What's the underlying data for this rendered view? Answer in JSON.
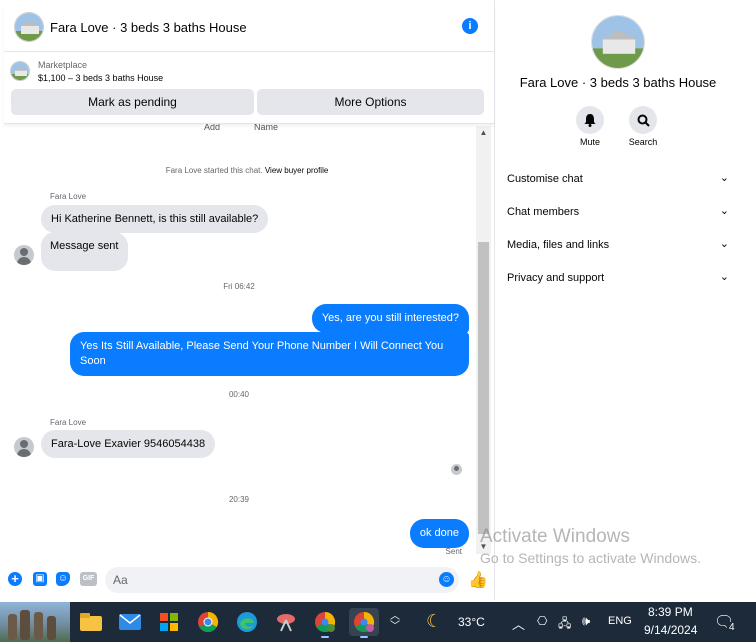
{
  "header": {
    "title": "Fara Love · 3 beds 3 baths House",
    "marketplace_label": "Marketplace",
    "listing_title": "$1,100 – 3 beds 3 baths House",
    "mark_pending_label": "Mark as pending",
    "more_options_label": "More Options",
    "cutoff_left": "Add",
    "cutoff_right": "Name"
  },
  "messages": {
    "system_text": "Fara Love started this chat.",
    "system_link": "View buyer profile",
    "sender1": "Fara Love",
    "msg1": "Hi Katherine Bennett, is this still available?",
    "msg2": "Message sent",
    "ts1": "Fri 06:42",
    "out1": "Yes, are you still interested?",
    "out2": "Yes Its Still Available, Please Send Your Phone Number I Will Connect You Soon",
    "ts2": "00:40",
    "sender2": "Fara Love",
    "msg3": "Fara-Love Exavier 9546054438",
    "ts3": "20:39",
    "out3": "ok done",
    "sent_label": "Sent"
  },
  "composer": {
    "placeholder": "Aa",
    "gif_label": "GIF"
  },
  "info_panel": {
    "title": "Fara Love · 3 beds 3 baths House",
    "mute_label": "Mute",
    "search_label": "Search",
    "rows": [
      "Customise chat",
      "Chat members",
      "Media, files and links",
      "Privacy and support"
    ]
  },
  "watermark": {
    "line1": "Activate Windows",
    "line2": "Go to Settings to activate Windows."
  },
  "taskbar": {
    "temperature": "33°C",
    "language": "ENG",
    "time": "8:39 PM",
    "date": "9/14/2024",
    "notification_count": "4"
  },
  "colors": {
    "messenger_blue": "#0a7cff",
    "incoming_bubble": "#e4e6eb",
    "taskbar": "#1c2a3a"
  }
}
